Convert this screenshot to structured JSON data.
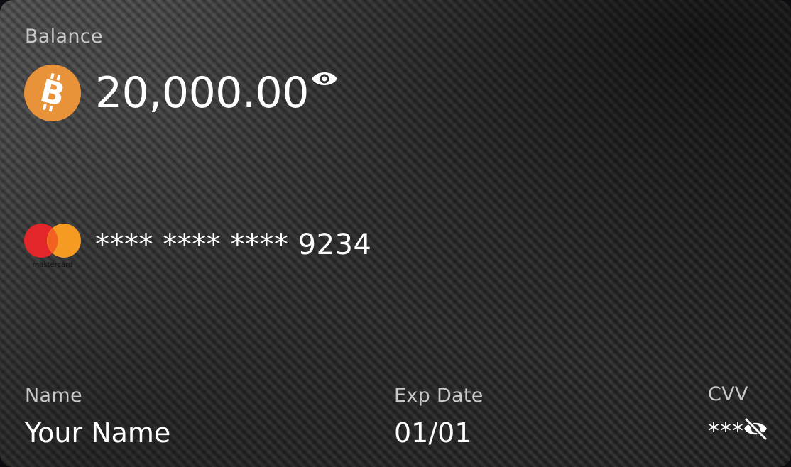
{
  "balance": {
    "label": "Balance",
    "amount": "20,000.00",
    "currency_icon": "bitcoin-icon",
    "currency_color": "#F7931A",
    "visibility_icon": "eye-icon"
  },
  "card": {
    "brand_icon": "mastercard-logo",
    "brand_text": "mastercard",
    "brand_colors": {
      "red": "#EB001B",
      "orange": "#F79E1B"
    },
    "number_masked": "**** **** **** 9234"
  },
  "holder": {
    "label": "Name",
    "value": "Your Name"
  },
  "expiry": {
    "label": "Exp Date",
    "value": "01/01"
  },
  "cvv": {
    "label": "CVV",
    "value": "***",
    "visibility_icon": "eye-off-icon"
  }
}
